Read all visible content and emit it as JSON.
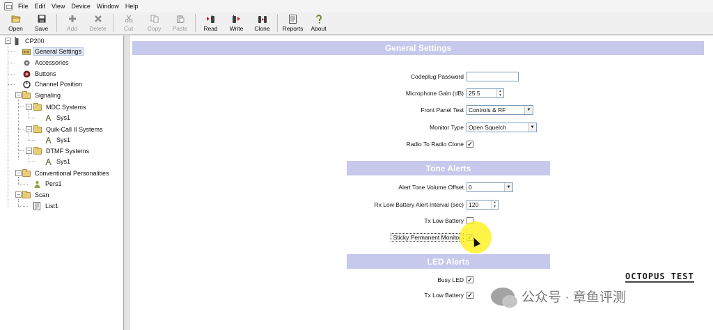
{
  "menubar": {
    "items": [
      "File",
      "Edit",
      "View",
      "Device",
      "Window",
      "Help"
    ]
  },
  "toolbar": {
    "buttons": [
      {
        "label": "Open",
        "icon": "folder-open-icon",
        "enabled": true
      },
      {
        "label": "Save",
        "icon": "save-disk-icon",
        "enabled": true
      },
      {
        "label": "Add",
        "icon": "add-cross-icon",
        "enabled": false
      },
      {
        "label": "Delete",
        "icon": "delete-x-icon",
        "enabled": false
      },
      {
        "label": "Cut",
        "icon": "scissors-icon",
        "enabled": false
      },
      {
        "label": "Copy",
        "icon": "copy-pages-icon",
        "enabled": false
      },
      {
        "label": "Paste",
        "icon": "paste-clipboard-icon",
        "enabled": false
      },
      {
        "label": "Read",
        "icon": "radio-read-icon",
        "enabled": true
      },
      {
        "label": "Write",
        "icon": "radio-write-icon",
        "enabled": true
      },
      {
        "label": "Clone",
        "icon": "radio-clone-icon",
        "enabled": true
      },
      {
        "label": "Reports",
        "icon": "report-page-icon",
        "enabled": true
      },
      {
        "label": "About",
        "icon": "about-question-icon",
        "enabled": true
      }
    ]
  },
  "tree": {
    "root": "CP200",
    "general_settings": "General Settings",
    "accessories": "Accessories",
    "buttons": "Buttons",
    "channel_position": "Channel Position",
    "signaling": "Signaling",
    "mdc_systems": "MDC Systems",
    "mdc_sys1": "Sys1",
    "quikcall": "Quik-Call II Systems",
    "quikcall_sys1": "Sys1",
    "dtmf": "DTMF Systems",
    "dtmf_sys1": "Sys1",
    "conventional": "Conventional Personalities",
    "pers1": "Pers1",
    "scan": "Scan",
    "list1": "List1"
  },
  "general": {
    "title": "General Settings",
    "codeplug_password_label": "Codeplug Password",
    "codeplug_password_value": "",
    "mic_gain_label": "Microphone Gain (dB)",
    "mic_gain_value": "25.5",
    "front_panel_label": "Front Panel Test",
    "front_panel_value": "Controls & RF",
    "monitor_type_label": "Monitor Type",
    "monitor_type_value": "Open Squelch",
    "radio_clone_label": "Radio To Radio Clone",
    "radio_clone_checked": "✓"
  },
  "tone": {
    "title": "Tone Alerts",
    "volume_offset_label": "Alert Tone Volume Offset",
    "volume_offset_value": "0",
    "low_batt_interval_label": "Rx Low Battery Alert Interval (sec)",
    "low_batt_interval_value": "120",
    "tx_low_battery_label": "Tx Low Battery",
    "tx_low_battery_checked": "",
    "sticky_monitor_label": "Sticky Permanent Monitor",
    "sticky_monitor_checked": "✓"
  },
  "led": {
    "title": "LED Alerts",
    "busy_led_label": "Busy LED",
    "busy_led_checked": "✓",
    "tx_low_battery_label": "Tx Low Battery",
    "tx_low_battery_checked": "✓"
  },
  "watermark": {
    "text": "公众号 · 章鱼评测",
    "brand": "OCTOPUS TEST"
  },
  "colors": {
    "section_header_bg": "#c6c8ec",
    "cursor_highlight": "#fff01e"
  }
}
